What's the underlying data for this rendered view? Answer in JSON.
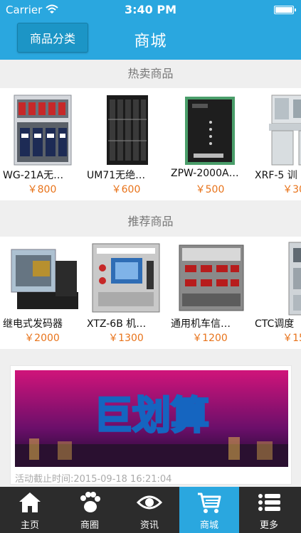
{
  "status_bar": {
    "carrier": "Carrier",
    "time": "3:40 PM"
  },
  "header": {
    "category_button": "商品分类",
    "title": "商城"
  },
  "hot_section": {
    "title": "热卖商品",
    "items": [
      {
        "name": "WG-21A无…",
        "price": "￥800",
        "icon": "relay-rack-photo"
      },
      {
        "name": "UM71无绝…",
        "price": "￥600",
        "icon": "black-cabinet-photo"
      },
      {
        "name": "ZPW-2000A…",
        "price": "￥500",
        "icon": "black-module-photo"
      },
      {
        "name": "XRF-5 训",
        "price": "￥30",
        "icon": "console-desk-photo"
      }
    ]
  },
  "recommend_section": {
    "title": "推荐商品",
    "items": [
      {
        "name": "继电式发码器",
        "price": "￥2000",
        "icon": "relay-device-photo"
      },
      {
        "name": "XTZ-6B 机…",
        "price": "￥1300",
        "icon": "test-instrument-photo"
      },
      {
        "name": "通用机车信…",
        "price": "￥1200",
        "icon": "signal-tester-photo"
      },
      {
        "name": "CTC调度",
        "price": "￥15",
        "icon": "control-cabinet-photo"
      }
    ]
  },
  "promo": {
    "banner_text": "巨划算",
    "deadline": "活动截止时间:2015-09-18 16:21:04"
  },
  "tab_bar": {
    "items": [
      {
        "label": "主页",
        "icon": "home-icon"
      },
      {
        "label": "商圈",
        "icon": "paw-icon"
      },
      {
        "label": "资讯",
        "icon": "eye-icon"
      },
      {
        "label": "商城",
        "icon": "cart-icon",
        "active": true
      },
      {
        "label": "更多",
        "icon": "list-icon"
      }
    ]
  },
  "colors": {
    "accent": "#2aa7df",
    "price": "#e8731a",
    "tabbar": "#2c2c2c"
  }
}
